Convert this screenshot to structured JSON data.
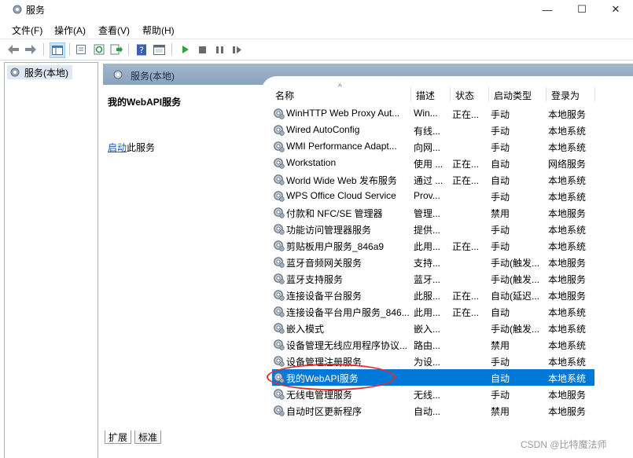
{
  "window": {
    "title": "服务",
    "minimize_label": "—",
    "maximize_label": "☐",
    "close_label": "✕"
  },
  "menu": [
    "文件(F)",
    "操作(A)",
    "查看(V)",
    "帮助(H)"
  ],
  "tree": {
    "item_label": "服务(本地)"
  },
  "header": {
    "title": "服务(本地)"
  },
  "detail": {
    "service_name": "我的WebAPI服务",
    "start_link": "启动",
    "start_suffix": "此服务"
  },
  "columns": [
    "名称",
    "描述",
    "状态",
    "启动类型",
    "登录为"
  ],
  "rows": [
    {
      "name": "WinHTTP Web Proxy Aut...",
      "desc": "Win...",
      "status": "正在...",
      "start": "手动",
      "logon": "本地服务"
    },
    {
      "name": "Wired AutoConfig",
      "desc": "有线...",
      "status": "",
      "start": "手动",
      "logon": "本地系统"
    },
    {
      "name": "WMI Performance Adapt...",
      "desc": "向网...",
      "status": "",
      "start": "手动",
      "logon": "本地系统"
    },
    {
      "name": "Workstation",
      "desc": "使用 ...",
      "status": "正在...",
      "start": "自动",
      "logon": "网络服务"
    },
    {
      "name": "World Wide Web 发布服务",
      "desc": "通过 ...",
      "status": "正在...",
      "start": "自动",
      "logon": "本地系统"
    },
    {
      "name": "WPS Office Cloud Service",
      "desc": "Prov...",
      "status": "",
      "start": "手动",
      "logon": "本地系统"
    },
    {
      "name": "付款和 NFC/SE 管理器",
      "desc": "管理...",
      "status": "",
      "start": "禁用",
      "logon": "本地服务"
    },
    {
      "name": "功能访问管理器服务",
      "desc": "提供...",
      "status": "",
      "start": "手动",
      "logon": "本地系统"
    },
    {
      "name": "剪贴板用户服务_846a9",
      "desc": "此用...",
      "status": "正在...",
      "start": "手动",
      "logon": "本地系统"
    },
    {
      "name": "蓝牙音频网关服务",
      "desc": "支持...",
      "status": "",
      "start": "手动(触发...",
      "logon": "本地服务"
    },
    {
      "name": "蓝牙支持服务",
      "desc": "蓝牙...",
      "status": "",
      "start": "手动(触发...",
      "logon": "本地服务"
    },
    {
      "name": "连接设备平台服务",
      "desc": "此服...",
      "status": "正在...",
      "start": "自动(延迟...",
      "logon": "本地服务"
    },
    {
      "name": "连接设备平台用户服务_846...",
      "desc": "此用...",
      "status": "正在...",
      "start": "自动",
      "logon": "本地系统"
    },
    {
      "name": "嵌入模式",
      "desc": "嵌入...",
      "status": "",
      "start": "手动(触发...",
      "logon": "本地系统"
    },
    {
      "name": "设备管理无线应用程序协议...",
      "desc": "路由...",
      "status": "",
      "start": "禁用",
      "logon": "本地系统"
    },
    {
      "name": "设备管理注册服务",
      "desc": "为设...",
      "status": "",
      "start": "手动",
      "logon": "本地系统"
    },
    {
      "name": "我的WebAPI服务",
      "desc": "",
      "status": "",
      "start": "自动",
      "logon": "本地系统"
    },
    {
      "name": "无线电管理服务",
      "desc": "无线...",
      "status": "",
      "start": "手动",
      "logon": "本地服务"
    },
    {
      "name": "自动时区更新程序",
      "desc": "自动...",
      "status": "",
      "start": "禁用",
      "logon": "本地服务"
    }
  ],
  "selected_row_index": 16,
  "tabs": [
    "扩展",
    "标准"
  ],
  "watermark": "CSDN @比特魔法师",
  "colors": {
    "selection": "#0078d7",
    "highlight_circle": "#e0302e",
    "header_band": "#98aec6"
  }
}
